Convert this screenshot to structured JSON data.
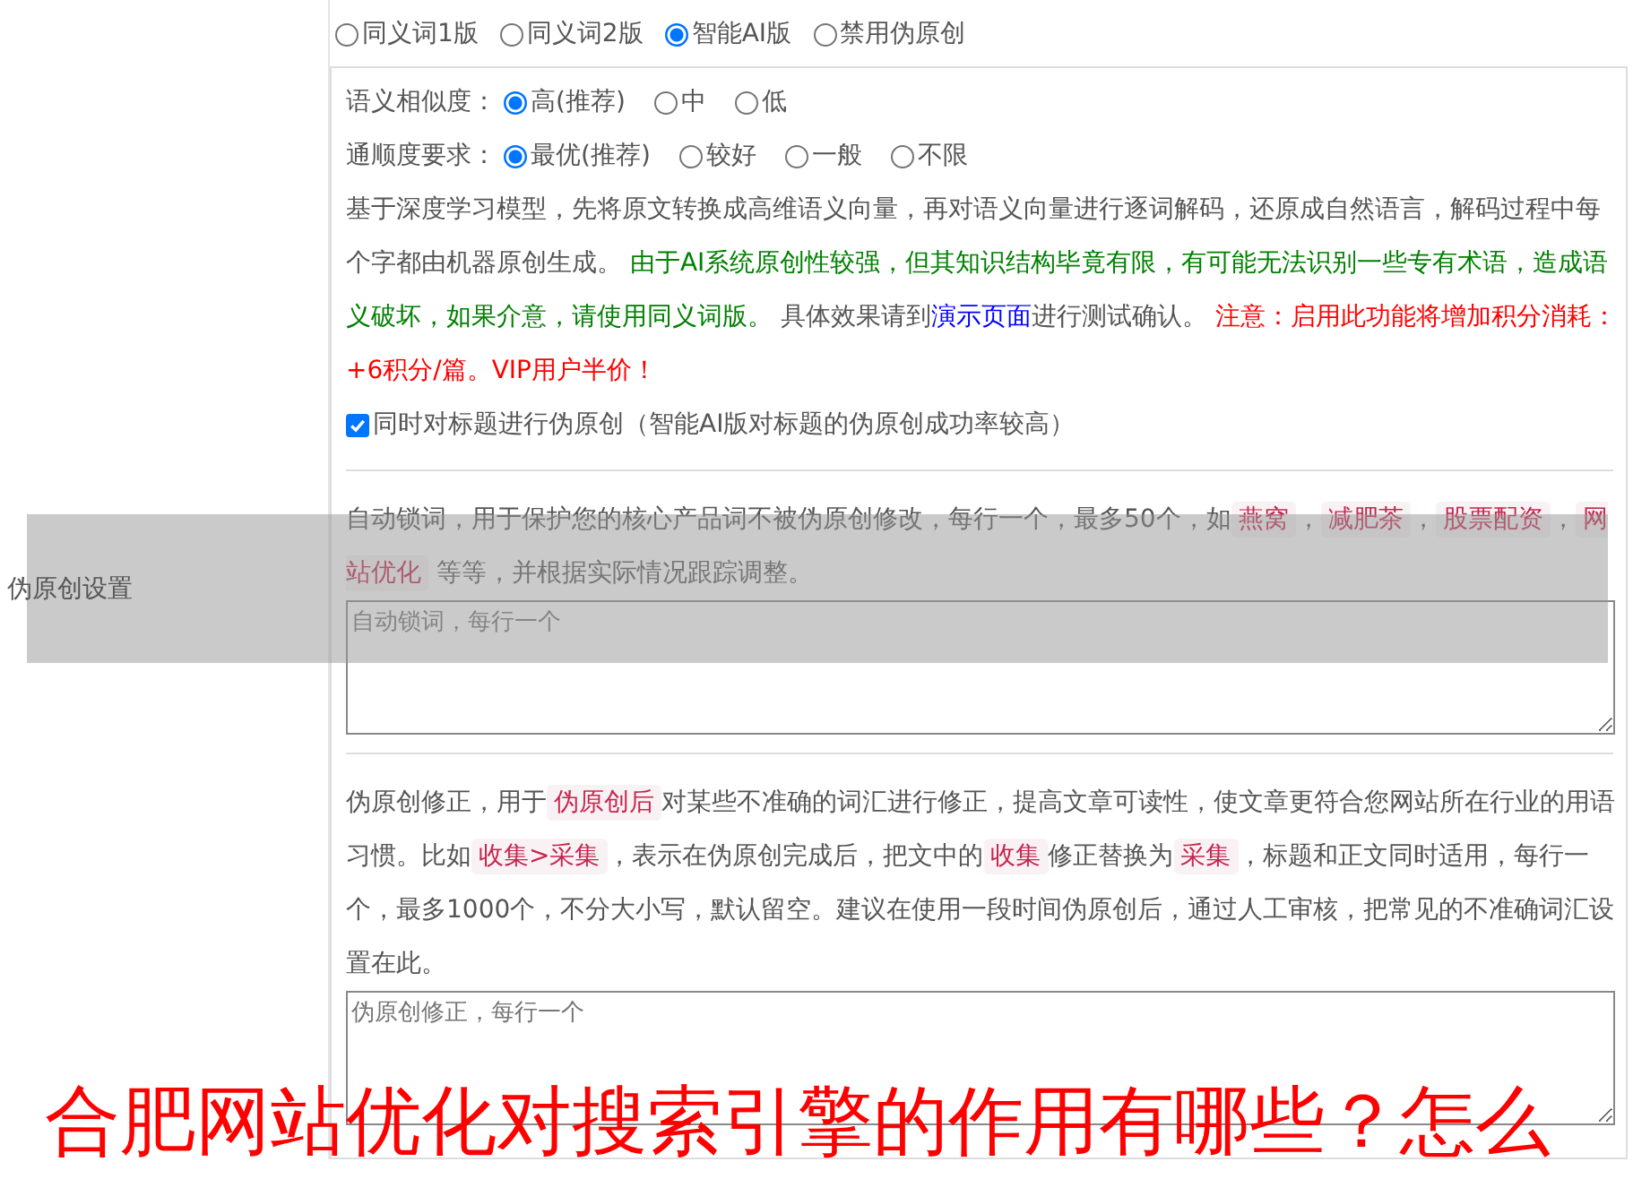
{
  "version_options": [
    {
      "label": "同义词1版",
      "selected": false
    },
    {
      "label": "同义词2版",
      "selected": false
    },
    {
      "label": "智能AI版",
      "selected": true
    },
    {
      "label": "禁用伪原创",
      "selected": false
    }
  ],
  "similarity": {
    "label": "语义相似度：",
    "options": [
      {
        "label": "高(推荐)",
        "selected": true
      },
      {
        "label": "中",
        "selected": false
      },
      {
        "label": "低",
        "selected": false
      }
    ]
  },
  "fluency": {
    "label": "通顺度要求：",
    "options": [
      {
        "label": "最优(推荐)",
        "selected": true
      },
      {
        "label": "较好",
        "selected": false
      },
      {
        "label": "一般",
        "selected": false
      },
      {
        "label": "不限",
        "selected": false
      }
    ]
  },
  "ai_description": [
    {
      "kind": "normal",
      "text": "基于深度学习模型，先将原文转换成高维语义向量，再对语义向量进行逐词解码，还原成自然语言，解码过程中每个字都由机器原创生成。 "
    },
    {
      "kind": "green",
      "text": "由于AI系统原创性较强，但其知识结构毕竟有限，有可能无法识别一些专有术语，造成语义破坏，如果介意，请使用同义词版。"
    },
    {
      "kind": "normal",
      "text": " 具体效果请到"
    },
    {
      "kind": "link",
      "text": "演示页面"
    },
    {
      "kind": "normal",
      "text": "进行测试确认。 "
    },
    {
      "kind": "red",
      "text": "注意：启用此功能将增加积分消耗：+6积分/篇。VIP用户半价！"
    }
  ],
  "title_option": {
    "label": "同时对标题进行伪原创（智能AI版对标题的伪原创成功率较高）",
    "checked": true
  },
  "section_label": "伪原创设置",
  "lock_words": {
    "description": [
      {
        "kind": "normal",
        "text": "自动锁词，用于保护您的核心产品词不被伪原创修改，每行一个，最多50个，如"
      },
      {
        "kind": "tag",
        "text": "燕窝"
      },
      {
        "kind": "normal",
        "text": "，"
      },
      {
        "kind": "tag",
        "text": "减肥茶"
      },
      {
        "kind": "normal",
        "text": "，"
      },
      {
        "kind": "tag",
        "text": "股票配资"
      },
      {
        "kind": "normal",
        "text": "，"
      },
      {
        "kind": "tag",
        "text": "网站优化"
      },
      {
        "kind": "normal",
        "text": " 等等，并根据实际情况跟踪调整。"
      }
    ],
    "placeholder": "自动锁词，每行一个"
  },
  "correction": {
    "description": [
      {
        "kind": "normal",
        "text": "伪原创修正，用于"
      },
      {
        "kind": "tag",
        "text": "伪原创后"
      },
      {
        "kind": "normal",
        "text": "对某些不准确的词汇进行修正，提高文章可读性，使文章更符合您网站所在行业的用语习惯。比如"
      },
      {
        "kind": "tag",
        "text": "收集>采集"
      },
      {
        "kind": "normal",
        "text": "，表示在伪原创完成后，把文中的"
      },
      {
        "kind": "tag",
        "text": "收集"
      },
      {
        "kind": "normal",
        "text": "修正替换为"
      },
      {
        "kind": "tag",
        "text": "采集"
      },
      {
        "kind": "normal",
        "text": "，标题和正文同时适用，每行一个，最多1000个，不分大小写，默认留空。建议在使用一段时间伪原创后，通过人工审核，把常见的不准确词汇设置在此。"
      }
    ],
    "placeholder": "伪原创修正，每行一个"
  },
  "caption": "合肥网站优化对搜索引擎的作用有哪些？怎么"
}
